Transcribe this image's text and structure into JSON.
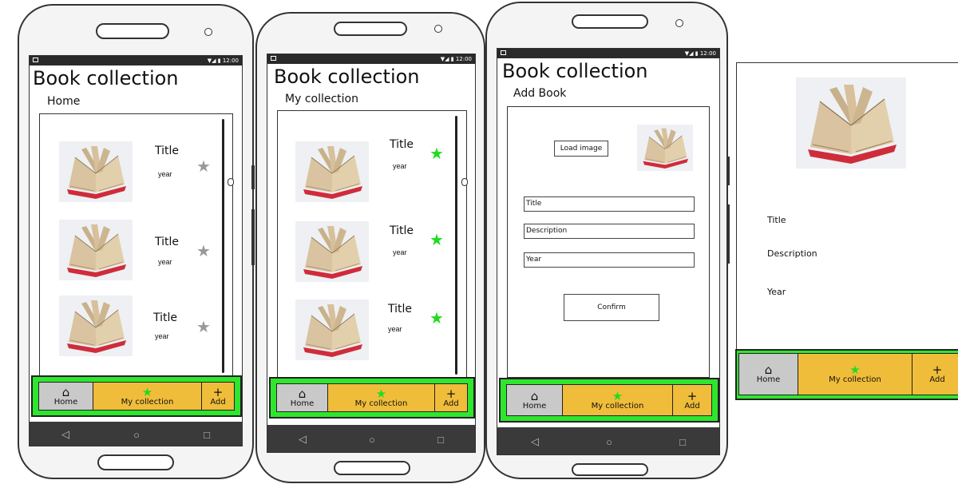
{
  "app_title": "Book collection",
  "status": {
    "time": "▼◢ ▮ 12:00"
  },
  "screens": {
    "home": {
      "subtitle": "Home"
    },
    "collection": {
      "subtitle": "My collection"
    },
    "add": {
      "subtitle": "Add Book",
      "load_image_label": "Load image",
      "title_placeholder": "Title",
      "description_placeholder": "Description",
      "year_placeholder": "Year",
      "confirm_label": "Confirm"
    },
    "detail": {
      "title_label": "Title",
      "description_label": "Description",
      "year_label": "Year"
    }
  },
  "books": [
    {
      "title": "Title",
      "year": "year"
    },
    {
      "title": "Title",
      "year": "year"
    },
    {
      "title": "Title",
      "year": "year"
    }
  ],
  "nav": {
    "home": "Home",
    "collection": "My collection",
    "add": "Add"
  },
  "icons": {
    "home": "house-icon",
    "collection": "star-icon",
    "add": "plus-icon"
  },
  "colors": {
    "nav_border": "#2ee62e",
    "tab_active": "#f0bd3a",
    "tab_home": "#c9c9c9",
    "star_gray": "#999999",
    "star_green": "#1fdc1f"
  }
}
